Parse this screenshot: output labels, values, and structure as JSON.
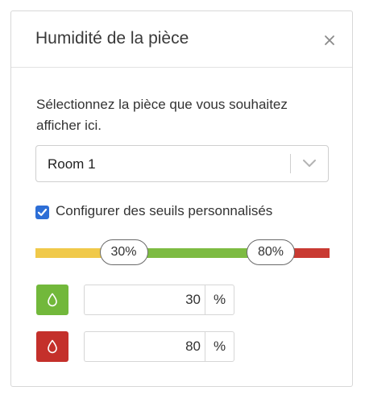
{
  "panel": {
    "title": "Humidité de la pièce",
    "close_icon": "close-icon"
  },
  "description": "Sélectionnez la pièce que vous souhaitez afficher ici.",
  "room_select": {
    "value": "Room 1",
    "icon": "chevron-down-icon"
  },
  "custom_thresholds": {
    "checked": true,
    "label": "Configurer des seuils personnalisés"
  },
  "threshold_bar": {
    "min": 0,
    "max": 100,
    "low_label": "30%",
    "high_label": "80%",
    "low_value": 30,
    "high_value": 80,
    "colors": {
      "low": "#f0c94a",
      "mid": "#7dbb42",
      "high": "#c93a32"
    }
  },
  "low_threshold": {
    "icon": "water-drop-icon",
    "color": "#72b83b",
    "value": "30",
    "unit": "%"
  },
  "high_threshold": {
    "icon": "water-drop-icon",
    "color": "#c4302b",
    "value": "80",
    "unit": "%"
  }
}
